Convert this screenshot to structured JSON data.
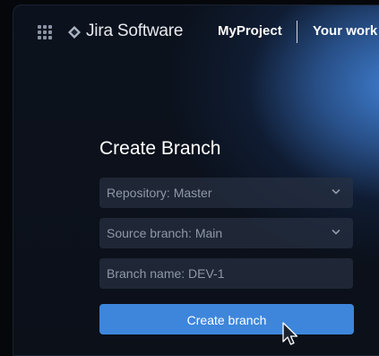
{
  "app": {
    "brand": "Jira Software",
    "icons": {
      "apps": "apps-grid-icon",
      "logo": "jira-logo-icon",
      "dropdown": "chevron-down-icon",
      "pointer": "mouse-pointer-icon"
    },
    "colors": {
      "accent": "#3d86db",
      "background": "#0b1019",
      "field_bg": "#273142",
      "text": "#ffffff"
    }
  },
  "nav": {
    "links": [
      "MyProject",
      "Your work"
    ]
  },
  "dialog": {
    "title": "Create Branch",
    "repository": {
      "label": "Repository: Master"
    },
    "source": {
      "label": "Source branch: Main"
    },
    "branch_name": {
      "value": "Branch name: DEV-1"
    },
    "submit_label": "Create branch"
  }
}
